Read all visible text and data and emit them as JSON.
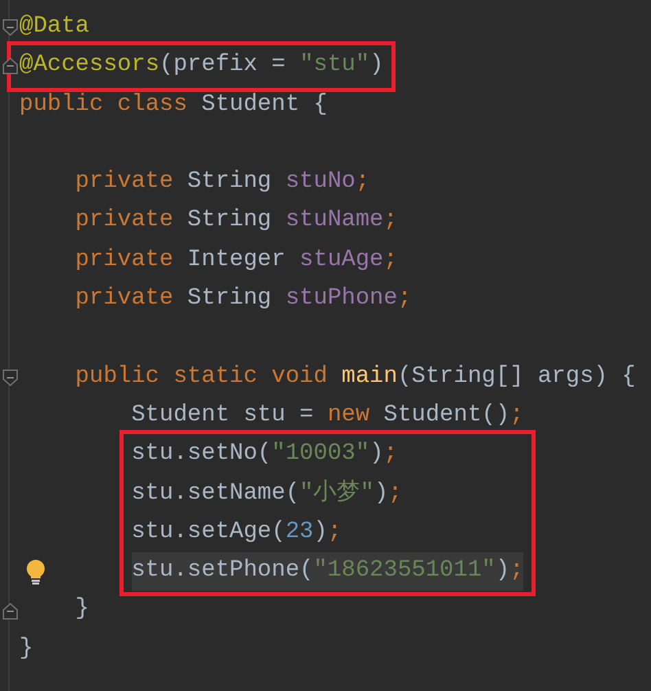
{
  "editor": {
    "lines": [
      {
        "kind": "code",
        "fold_start": true,
        "fold_end": false,
        "boxed": false,
        "current": false,
        "bulb": false,
        "tokens": [
          {
            "text": "@Data",
            "kind": "annotation"
          }
        ]
      },
      {
        "kind": "code",
        "fold_start": false,
        "fold_end": true,
        "boxed": true,
        "current": false,
        "bulb": false,
        "tokens": [
          {
            "text": "@Accessors",
            "kind": "annotation"
          },
          {
            "text": "(prefix = ",
            "kind": "plain"
          },
          {
            "text": "\"stu\"",
            "kind": "string"
          },
          {
            "text": ")",
            "kind": "plain"
          }
        ]
      },
      {
        "kind": "code",
        "fold_start": false,
        "fold_end": false,
        "boxed": false,
        "current": false,
        "bulb": false,
        "tokens": [
          {
            "text": "public class ",
            "kind": "keyword"
          },
          {
            "text": "Student {",
            "kind": "plain"
          }
        ],
        "children": [
          {
            "kind": "blank"
          },
          {
            "kind": "code",
            "fold_start": false,
            "fold_end": false,
            "boxed": false,
            "current": false,
            "bulb": false,
            "tokens": [
              {
                "text": "private ",
                "kind": "keyword"
              },
              {
                "text": "String ",
                "kind": "plain"
              },
              {
                "text": "stuNo",
                "kind": "field"
              },
              {
                "text": ";",
                "kind": "keyword"
              }
            ]
          },
          {
            "kind": "code",
            "fold_start": false,
            "fold_end": false,
            "boxed": false,
            "current": false,
            "bulb": false,
            "tokens": [
              {
                "text": "private ",
                "kind": "keyword"
              },
              {
                "text": "String ",
                "kind": "plain"
              },
              {
                "text": "stuName",
                "kind": "field"
              },
              {
                "text": ";",
                "kind": "keyword"
              }
            ]
          },
          {
            "kind": "code",
            "fold_start": false,
            "fold_end": false,
            "boxed": false,
            "current": false,
            "bulb": false,
            "tokens": [
              {
                "text": "private ",
                "kind": "keyword"
              },
              {
                "text": "Integer ",
                "kind": "plain"
              },
              {
                "text": "stuAge",
                "kind": "field"
              },
              {
                "text": ";",
                "kind": "keyword"
              }
            ]
          },
          {
            "kind": "code",
            "fold_start": false,
            "fold_end": false,
            "boxed": false,
            "current": false,
            "bulb": false,
            "tokens": [
              {
                "text": "private ",
                "kind": "keyword"
              },
              {
                "text": "String ",
                "kind": "plain"
              },
              {
                "text": "stuPhone",
                "kind": "field"
              },
              {
                "text": ";",
                "kind": "keyword"
              }
            ]
          },
          {
            "kind": "blank"
          },
          {
            "kind": "code",
            "fold_start": true,
            "fold_end": false,
            "boxed": false,
            "current": false,
            "bulb": false,
            "tokens": [
              {
                "text": "public static void ",
                "kind": "keyword"
              },
              {
                "text": "main",
                "kind": "method"
              },
              {
                "text": "(String[] args) {",
                "kind": "plain"
              }
            ],
            "children": [
              {
                "kind": "code",
                "fold_start": false,
                "fold_end": false,
                "boxed": false,
                "current": false,
                "bulb": false,
                "tokens": [
                  {
                    "text": "Student stu = ",
                    "kind": "plain"
                  },
                  {
                    "text": "new ",
                    "kind": "keyword"
                  },
                  {
                    "text": "Student()",
                    "kind": "plain"
                  },
                  {
                    "text": ";",
                    "kind": "keyword"
                  }
                ]
              },
              {
                "kind": "code",
                "fold_start": false,
                "fold_end": false,
                "boxed": true,
                "current": false,
                "bulb": false,
                "tokens": [
                  {
                    "text": "stu.setNo(",
                    "kind": "plain"
                  },
                  {
                    "text": "\"10003\"",
                    "kind": "string"
                  },
                  {
                    "text": ")",
                    "kind": "plain"
                  },
                  {
                    "text": ";",
                    "kind": "keyword"
                  }
                ]
              },
              {
                "kind": "code",
                "fold_start": false,
                "fold_end": false,
                "boxed": true,
                "current": false,
                "bulb": false,
                "tokens": [
                  {
                    "text": "stu.setName(",
                    "kind": "plain"
                  },
                  {
                    "text": "\"小梦\"",
                    "kind": "string"
                  },
                  {
                    "text": ")",
                    "kind": "plain"
                  },
                  {
                    "text": ";",
                    "kind": "keyword"
                  }
                ]
              },
              {
                "kind": "code",
                "fold_start": false,
                "fold_end": false,
                "boxed": true,
                "current": false,
                "bulb": false,
                "tokens": [
                  {
                    "text": "stu.setAge(",
                    "kind": "plain"
                  },
                  {
                    "text": "23",
                    "kind": "number"
                  },
                  {
                    "text": ")",
                    "kind": "plain"
                  },
                  {
                    "text": ";",
                    "kind": "keyword"
                  }
                ]
              },
              {
                "kind": "code",
                "fold_start": false,
                "fold_end": false,
                "boxed": true,
                "current": true,
                "bulb": true,
                "tokens": [
                  {
                    "text": "stu.setPhone(",
                    "kind": "plain"
                  },
                  {
                    "text": "\"18623551011\"",
                    "kind": "string"
                  },
                  {
                    "text": ")",
                    "kind": "plain"
                  },
                  {
                    "text": ";",
                    "kind": "keyword"
                  }
                ]
              }
            ]
          },
          {
            "kind": "code",
            "fold_start": false,
            "fold_end": true,
            "boxed": false,
            "current": false,
            "bulb": false,
            "tokens": [
              {
                "text": "}",
                "kind": "plain"
              }
            ]
          }
        ]
      },
      {
        "kind": "code",
        "fold_start": false,
        "fold_end": false,
        "boxed": false,
        "current": false,
        "bulb": false,
        "tokens": [
          {
            "text": "}",
            "kind": "plain"
          }
        ]
      }
    ]
  }
}
